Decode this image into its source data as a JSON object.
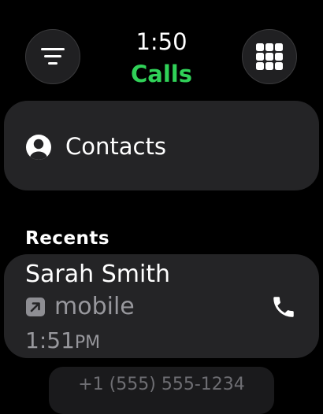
{
  "header": {
    "time": "1:50",
    "title": "Calls",
    "title_color": "#30d158",
    "left_button_icon": "filter-lines-icon",
    "right_button_icon": "keypad-grid-icon"
  },
  "contacts": {
    "label": "Contacts",
    "icon": "person-circle-icon"
  },
  "recents": {
    "section_title": "Recents",
    "items": [
      {
        "name": "Sarah Smith",
        "type": "mobile",
        "direction_icon": "outgoing-arrow-icon",
        "time": "1:51",
        "ampm": "PM",
        "action_icon": "phone-icon"
      },
      {
        "number": "+1 (555) 555-1234"
      }
    ]
  }
}
